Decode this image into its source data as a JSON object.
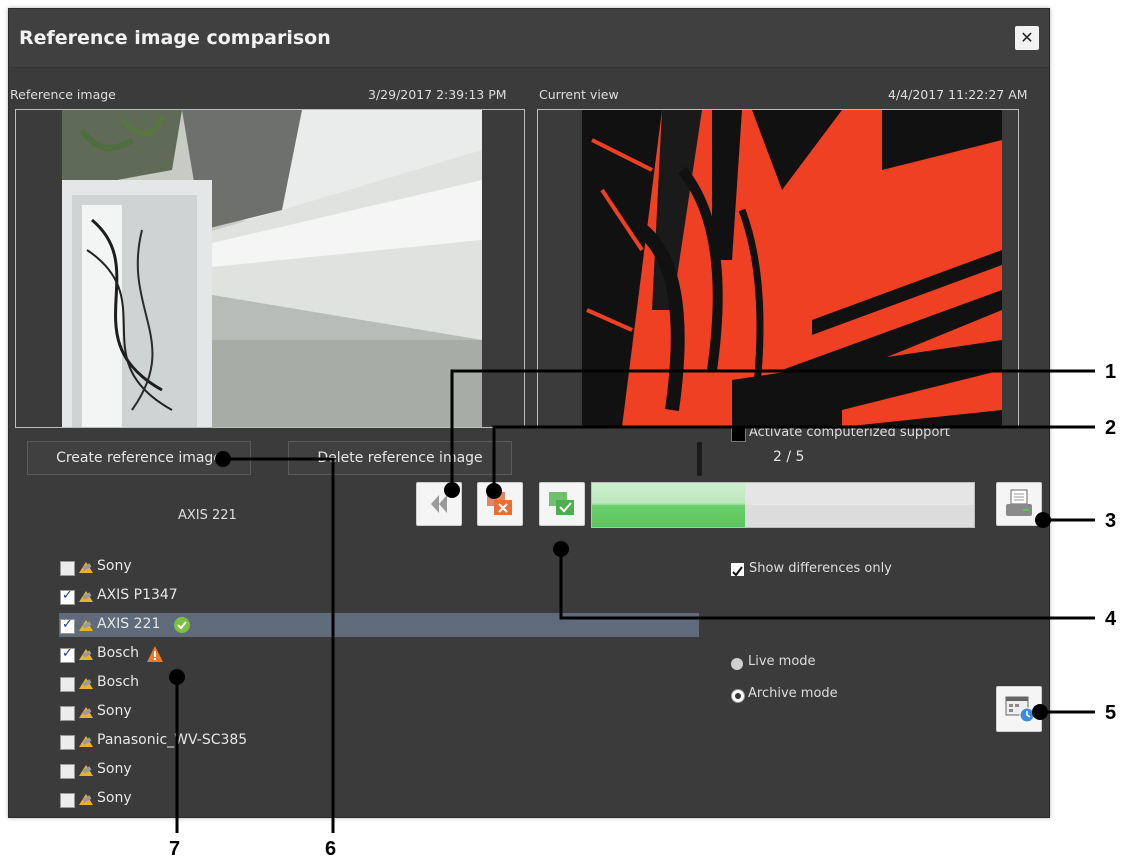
{
  "dialog": {
    "title": "Reference image comparison",
    "close_icon": "close-icon"
  },
  "reference": {
    "label": "Reference image",
    "timestamp": "3/29/2017 2:39:13 PM"
  },
  "current": {
    "label": "Current view",
    "timestamp": "4/4/2017 11:22:27 AM"
  },
  "buttons": {
    "create": "Create reference image",
    "delete": "Delete reference image"
  },
  "counter": "2 / 5",
  "camera_name": "AXIS 221",
  "progress": {
    "fraction": 0.4
  },
  "options": {
    "show_differences": {
      "label": "Show differences only",
      "checked": true
    },
    "computerized_support": {
      "label": "Activate computerized support",
      "checked": false
    },
    "live_mode": "Live mode",
    "archive_mode": "Archive mode",
    "selected_mode": "Archive mode"
  },
  "camera_list": [
    {
      "name": "Sony",
      "checked": false,
      "status": ""
    },
    {
      "name": "AXIS P1347",
      "checked": true,
      "status": ""
    },
    {
      "name": "AXIS 221",
      "checked": true,
      "status": "ok",
      "selected": true
    },
    {
      "name": "Bosch",
      "checked": true,
      "status": "warning"
    },
    {
      "name": "Bosch",
      "checked": false,
      "status": ""
    },
    {
      "name": "Sony",
      "checked": false,
      "status": ""
    },
    {
      "name": "Panasonic_WV-SC385",
      "checked": false,
      "status": ""
    },
    {
      "name": "Sony",
      "checked": false,
      "status": ""
    },
    {
      "name": "Sony",
      "checked": false,
      "status": ""
    }
  ],
  "callouts": [
    "1",
    "2",
    "3",
    "4",
    "5",
    "6",
    "7"
  ],
  "colors": {
    "dialog_bg": "#3b3b3b",
    "diff_red": "#ef4023",
    "progress_green": "#5cc45e",
    "selection": "#5f6b7a"
  }
}
